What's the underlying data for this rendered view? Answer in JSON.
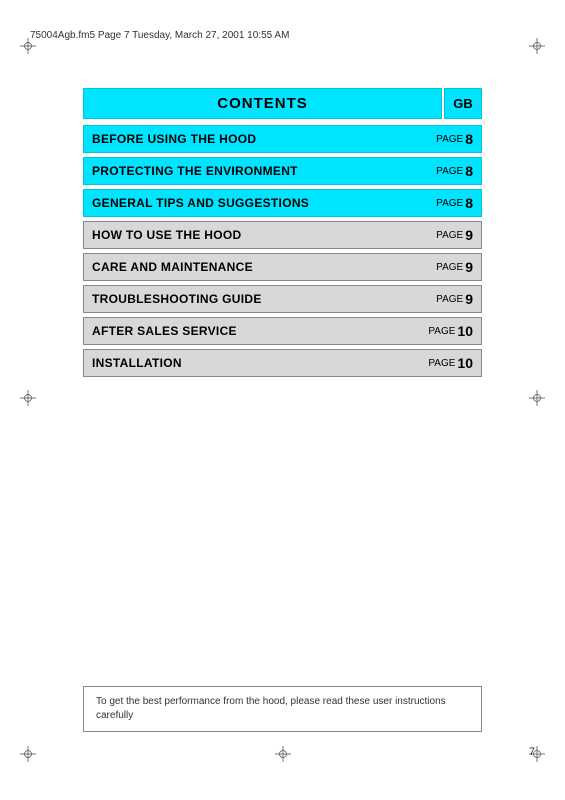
{
  "header": {
    "file_info": "75004Agb.fm5  Page 7  Tuesday, March 27, 2001  10:55 AM"
  },
  "contents": {
    "title": "CONTENTS",
    "gb_label": "GB",
    "rows": [
      {
        "label": "BEFORE USING THE HOOD",
        "page_word": "PAGE",
        "page_num": "8",
        "style": "cyan"
      },
      {
        "label": "PROTECTING THE ENVIRONMENT",
        "page_word": "PAGE",
        "page_num": "8",
        "style": "cyan"
      },
      {
        "label": "GENERAL TIPS AND SUGGESTIONS",
        "page_word": "PAGE",
        "page_num": "8",
        "style": "cyan"
      },
      {
        "label": "HOW TO USE THE HOOD",
        "page_word": "PAGE",
        "page_num": "9",
        "style": "normal"
      },
      {
        "label": "CARE AND MAINTENANCE",
        "page_word": "PAGE",
        "page_num": "9",
        "style": "normal"
      },
      {
        "label": "TROUBLESHOOTING GUIDE",
        "page_word": "PAGE",
        "page_num": "9",
        "style": "normal"
      },
      {
        "label": "AFTER SALES SERVICE",
        "page_word": "PAGE",
        "page_num": "10",
        "style": "normal"
      },
      {
        "label": "INSTALLATION",
        "page_word": "PAGE",
        "page_num": "10",
        "style": "normal"
      }
    ]
  },
  "bottom_note": "To get the best performance from the hood, please read these user instructions carefully",
  "page_number": "7"
}
